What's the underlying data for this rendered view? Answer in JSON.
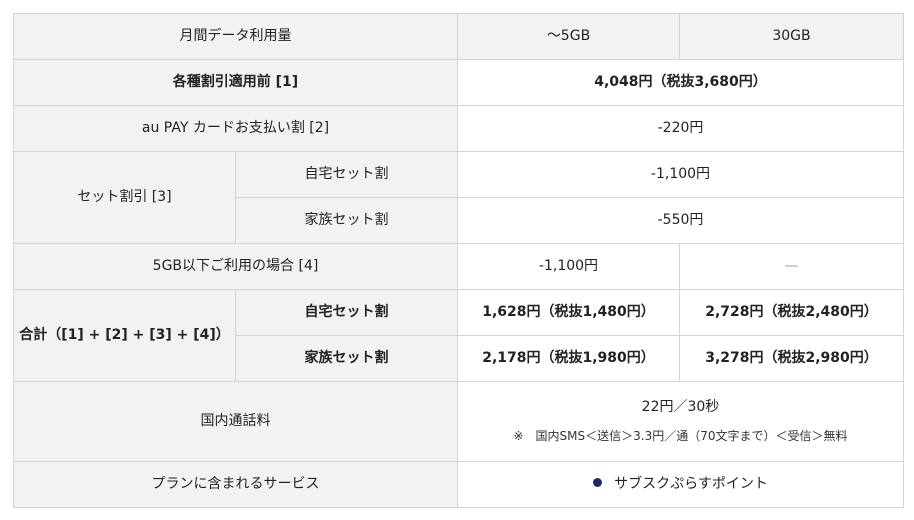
{
  "header": {
    "label": "月間データ利用量",
    "plan1": "〜5GB",
    "plan2": "30GB"
  },
  "base": {
    "label": "各種割引適用前 [1]",
    "value": "4,048円（税抜3,680円）"
  },
  "au_pay": {
    "label": "au PAY カードお支払い割 [2]",
    "value": "-220円"
  },
  "set_discount": {
    "label": "セット割引 [3]",
    "home": {
      "label": "自宅セット割",
      "value": "-1,100円"
    },
    "family": {
      "label": "家族セット割",
      "value": "-550円"
    }
  },
  "under5gb": {
    "label": "5GB以下ご利用の場合 [4]",
    "value1": "-1,100円",
    "value2": "—"
  },
  "total": {
    "label": "合計（[1] + [2] + [3] + [4]）",
    "home": {
      "label": "自宅セット割",
      "value1": "1,628円（税抜1,480円）",
      "value2": "2,728円（税抜2,480円）"
    },
    "family": {
      "label": "家族セット割",
      "value1": "2,178円（税抜1,980円）",
      "value2": "3,278円（税抜2,980円）"
    }
  },
  "domestic_call": {
    "label": "国内通話料",
    "value": "22円／30秒",
    "note": "※　国内SMS＜送信＞3.3円／通（70文字まで）＜受信＞無料"
  },
  "services": {
    "label": "プランに含まれるサービス",
    "value": "サブスクぷらすポイント",
    "bullet_color": "#1b2a6b"
  }
}
